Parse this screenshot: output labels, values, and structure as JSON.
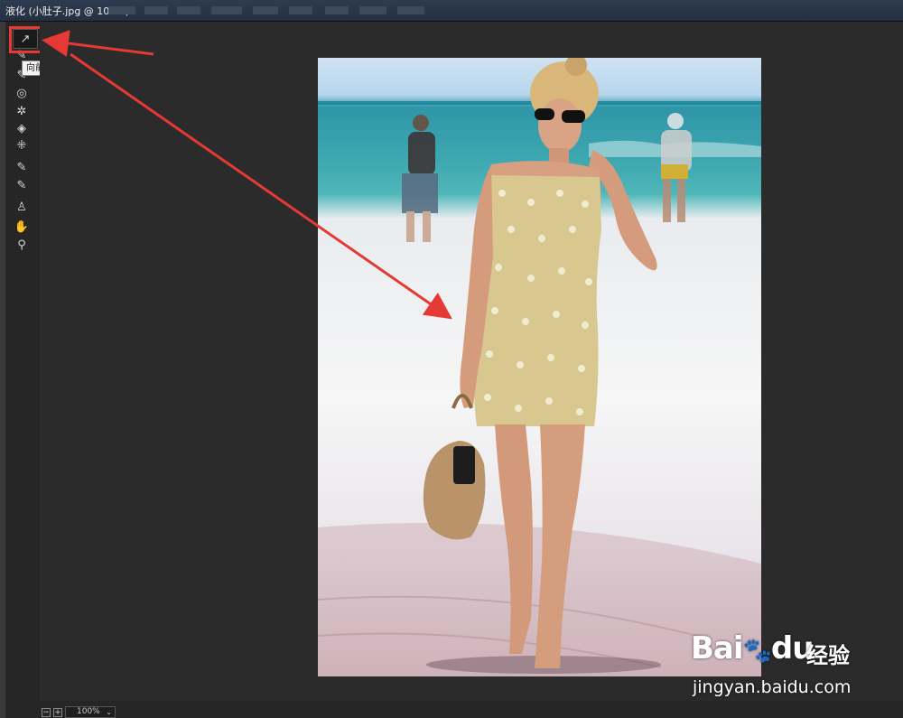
{
  "window": {
    "title": "液化 (小肚子.jpg @ 100%)"
  },
  "tools": [
    {
      "name": "forward-warp-tool",
      "glyph": "↗",
      "active": true
    },
    {
      "name": "reconstruct-tool",
      "glyph": "✎"
    },
    {
      "name": "smooth-tool",
      "glyph": "✎"
    },
    {
      "name": "twirl-tool",
      "glyph": "◎"
    },
    {
      "name": "pucker-tool",
      "glyph": "✲"
    },
    {
      "name": "bloat-tool",
      "glyph": "◈"
    },
    {
      "name": "push-left-tool",
      "glyph": "⁜"
    },
    {
      "name": "freeze-mask-tool",
      "glyph": "✎"
    },
    {
      "name": "thaw-mask-tool",
      "glyph": "✎"
    },
    {
      "name": "face-tool",
      "glyph": "♙"
    },
    {
      "name": "hand-tool",
      "glyph": "✋"
    },
    {
      "name": "zoom-tool",
      "glyph": "⚲"
    }
  ],
  "tooltip": {
    "text": "向前变形工具 (W)"
  },
  "zoom": {
    "value": "100%",
    "minus": "−",
    "plus": "+",
    "caret": "⌄"
  },
  "watermark": {
    "brand": "Bai",
    "brand_suffix": "du",
    "chinese": "经验",
    "url": "jingyan.baidu.com"
  },
  "colors": {
    "annotation": "#e53935"
  }
}
